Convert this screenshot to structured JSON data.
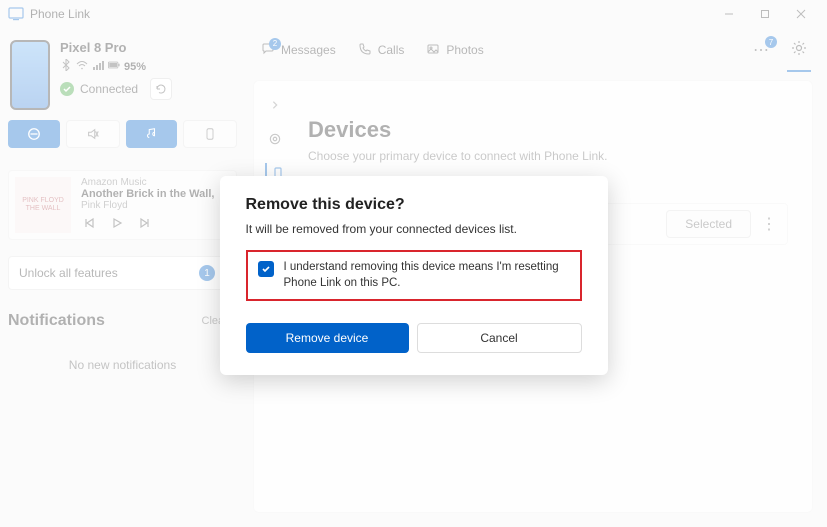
{
  "app": {
    "title": "Phone Link"
  },
  "device": {
    "name": "Pixel 8 Pro",
    "battery_text": "95%",
    "connection_label": "Connected"
  },
  "now_playing": {
    "source": "Amazon Music",
    "title": "Another Brick in the Wall,",
    "artist": "Pink Floyd",
    "art_text": "PINK FLOYD THE WALL"
  },
  "unlock": {
    "label": "Unlock all features",
    "badge": "1"
  },
  "notifications": {
    "title": "Notifications",
    "clear_label": "Clear a",
    "empty_text": "No new notifications"
  },
  "tabs": {
    "messages": {
      "label": "Messages",
      "badge": "2"
    },
    "calls": {
      "label": "Calls"
    },
    "photos": {
      "label": "Photos"
    },
    "overflow_badge": "7"
  },
  "settings": {
    "title": "Devices",
    "subtitle": "Choose your primary device to connect with Phone Link.",
    "selected_label": "Selected"
  },
  "dialog": {
    "title": "Remove this device?",
    "body": "It will be removed from your connected devices list.",
    "consent": "I understand removing this device means I'm resetting Phone Link on this PC.",
    "remove_label": "Remove device",
    "cancel_label": "Cancel"
  }
}
